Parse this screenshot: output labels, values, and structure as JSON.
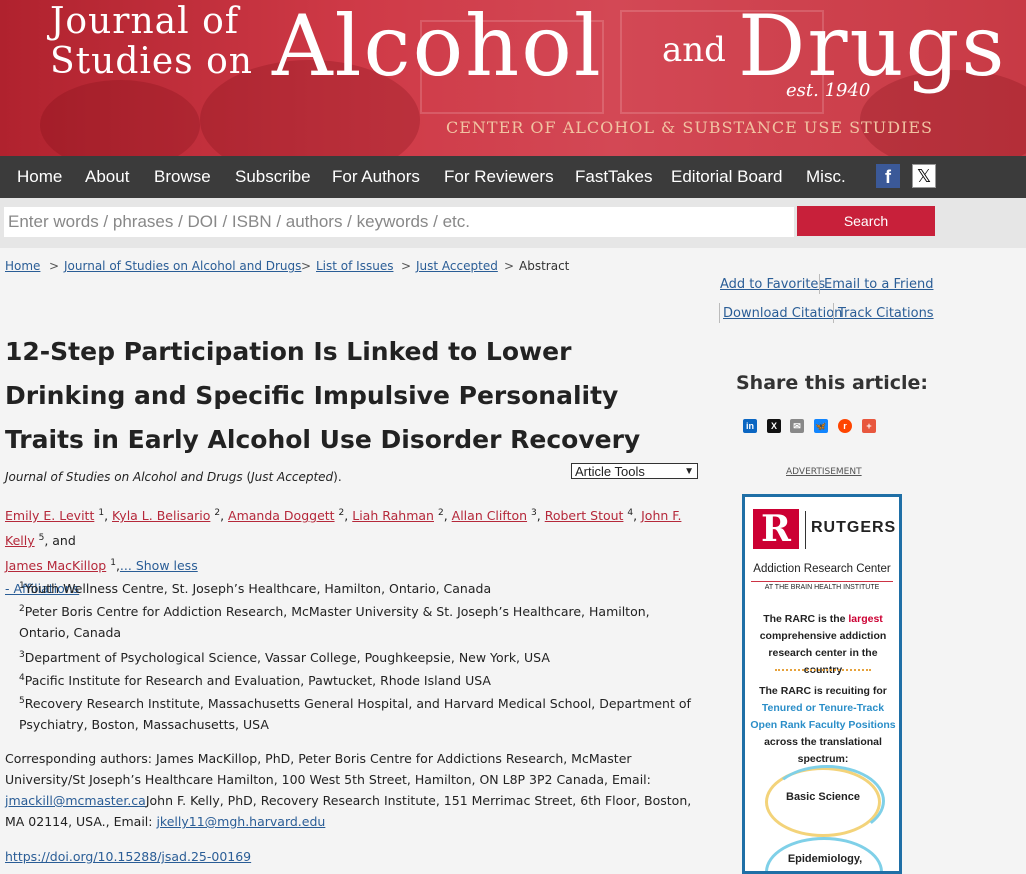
{
  "banner": {
    "journal_line1": "Journal of",
    "journal_line2": "Studies on",
    "alcohol": "Alcohol",
    "and": "and",
    "drugs": "Drugs",
    "est": "est. 1940",
    "center": "CENTER OF ALCOHOL & SUBSTANCE USE STUDIES"
  },
  "nav": {
    "items": [
      "Home",
      "About",
      "Browse",
      "Subscribe",
      "For Authors",
      "For Reviewers",
      "FastTakes",
      "Editorial Board",
      "Misc."
    ],
    "facebook": "f",
    "x": "𝕏"
  },
  "search": {
    "placeholder": "Enter words / phrases / DOI / ISBN / authors / keywords / etc.",
    "button": "Search"
  },
  "breadcrumb": {
    "items": [
      "Home",
      "Journal of Studies on Alcohol and Drugs",
      "List of Issues",
      "Just Accepted"
    ],
    "current": "Abstract",
    "sep": ">"
  },
  "actions": {
    "add_favorites": "Add to Favorites",
    "email_friend": "Email to a Friend",
    "download_citation": "Download Citation",
    "track_citations": "Track Citations"
  },
  "article": {
    "title": "12-Step Participation Is Linked to Lower Drinking and Specific Impulsive Personality Traits in Early Alcohol Use Disorder Recovery",
    "journal": "Journal of Studies on Alcohol and Drugs",
    "journal_status": "Just Accepted",
    "tools_label": "Article Tools",
    "authors": [
      {
        "name": "Emily E. Levitt",
        "sup": "1"
      },
      {
        "name": "Kyla L. Belisario",
        "sup": "2"
      },
      {
        "name": "Amanda Doggett",
        "sup": "2"
      },
      {
        "name": "Liah Rahman",
        "sup": "2"
      },
      {
        "name": "Allan Clifton",
        "sup": "3"
      },
      {
        "name": "Robert Stout",
        "sup": "4"
      },
      {
        "name": "John F. Kelly",
        "sup": "5"
      },
      {
        "name": "James MacKillop",
        "sup": "1"
      }
    ],
    "and_text": ", and",
    "show_less": "... Show less",
    "affiliations_toggle": "- Affiliations",
    "affiliations": [
      {
        "sup": "1",
        "text": "Youth Wellness Centre, St. Joseph’s Healthcare, Hamilton, Ontario, Canada"
      },
      {
        "sup": "2",
        "text": "Peter Boris Centre for Addiction Research, McMaster University & St. Joseph’s Healthcare, Hamilton, Ontario, Canada"
      },
      {
        "sup": "3",
        "text": "Department of Psychological Science, Vassar College, Poughkeepsie, New York, USA"
      },
      {
        "sup": "4",
        "text": "Pacific Institute for Research and Evaluation, Pawtucket, Rhode Island USA"
      },
      {
        "sup": "5",
        "text": "Recovery Research Institute, Massachusetts General Hospital, and Harvard Medical School, Department of Psychiatry, Boston, Massachusetts, USA"
      }
    ],
    "corresponding_a": "Corresponding authors: James MacKillop, PhD, Peter Boris Centre for Addictions Research, McMaster University/St Joseph’s Healthcare Hamilton, 100 West 5th Street, Hamilton, ON L8P 3P2 Canada, Email: ",
    "email1": "jmackill@mcmaster.ca",
    "corresponding_b": "John F. Kelly, PhD, Recovery Research Institute, 151 Merrimac Street, 6th Floor, Boston, MA 02114, USA., Email: ",
    "email2": "jkelly11@mgh.harvard.edu",
    "doi": "https://doi.org/10.15288/jsad.25-00169"
  },
  "share": {
    "title": "Share this article:",
    "icons": [
      {
        "name": "linkedin-icon",
        "glyph": "in",
        "color": "#0a66c2"
      },
      {
        "name": "x-icon",
        "glyph": "X",
        "color": "#111111"
      },
      {
        "name": "email-icon",
        "glyph": "✉",
        "color": "#888888"
      },
      {
        "name": "bluesky-icon",
        "glyph": "🦋",
        "color": "#1185fe"
      },
      {
        "name": "reddit-icon",
        "glyph": "r",
        "color": "#ff4500"
      },
      {
        "name": "more-icon",
        "glyph": "+",
        "color": "#e8573e"
      }
    ],
    "advertisement": "ADVERTISEMENT"
  },
  "ad": {
    "r": "R",
    "rutgers": "RUTGERS",
    "center": "Addiction Research Center",
    "sub": "AT THE BRAIN HEALTH INSTITUTE",
    "p1a": "The RARC is the ",
    "p1b": "largest",
    "p1c": " comprehensive addiction research center in the country",
    "p2a": "The RARC is recuiting for ",
    "p2b": "Tenured or Tenure-Track Open Rank Faculty Positions",
    "p2c": " across the translational spectrum:",
    "basic": "Basic Science",
    "epi": "Epidemiology,"
  }
}
